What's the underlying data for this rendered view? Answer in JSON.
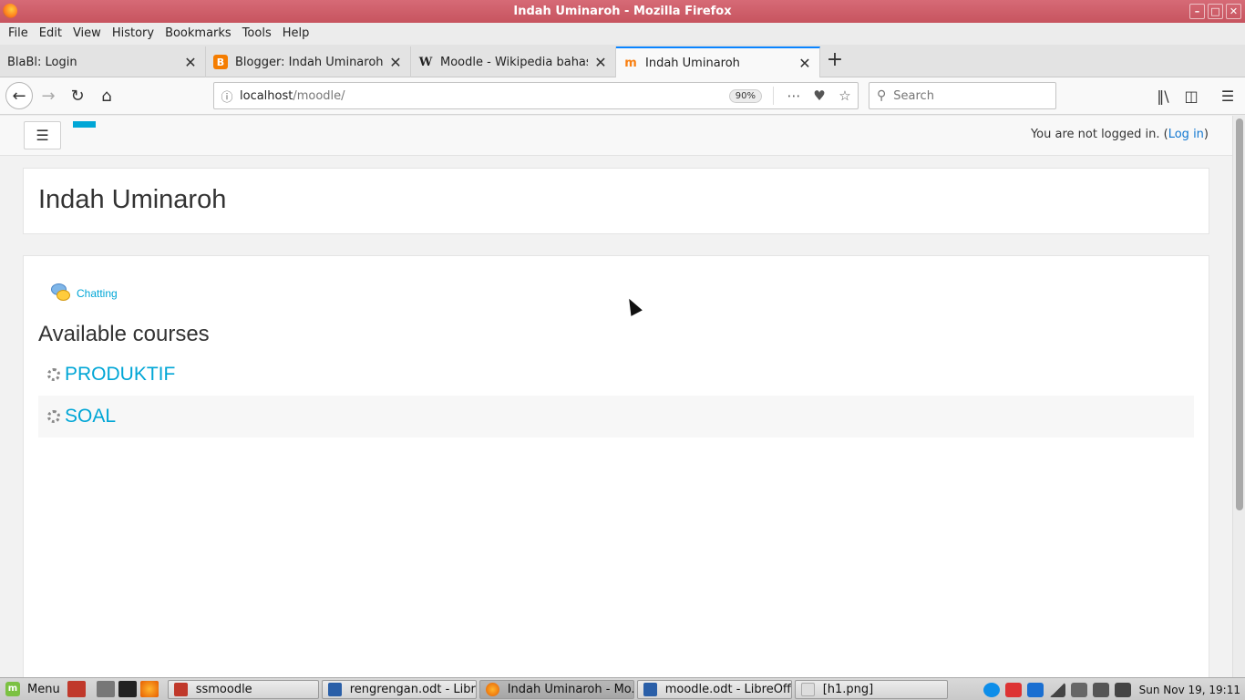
{
  "window": {
    "title": "Indah Uminaroh - Mozilla Firefox"
  },
  "menu": [
    "File",
    "Edit",
    "View",
    "History",
    "Bookmarks",
    "Tools",
    "Help"
  ],
  "tabs": [
    {
      "title": "BlaBl: Login"
    },
    {
      "title": "Blogger: Indah Uminaroh | | E"
    },
    {
      "title": "Moodle - Wikipedia bahasa In"
    },
    {
      "title": "Indah Uminaroh"
    }
  ],
  "address": {
    "host": "localhost",
    "path": "/moodle/",
    "zoom": "90%"
  },
  "search": {
    "placeholder": "Search"
  },
  "page": {
    "login_text": "You are not logged in. (",
    "login_link": "Log in",
    "login_close": ")",
    "site_title": "Indah Uminaroh",
    "activity": "Chatting",
    "courses_heading": "Available courses",
    "courses": [
      "PRODUKTIF",
      "SOAL"
    ]
  },
  "taskbar": {
    "menu_label": "Menu",
    "tasks": [
      "ssmoodle",
      "rengrengan.odt - Libr...",
      "Indah Uminaroh - Mo...",
      "moodle.odt - LibreOffi...",
      "[h1.png]"
    ],
    "clock": "Sun Nov 19, 19:11"
  },
  "colors": {
    "link": "#00a6d6",
    "titlebar": "#c7545f",
    "active_tab_accent": "#0a84ff"
  }
}
